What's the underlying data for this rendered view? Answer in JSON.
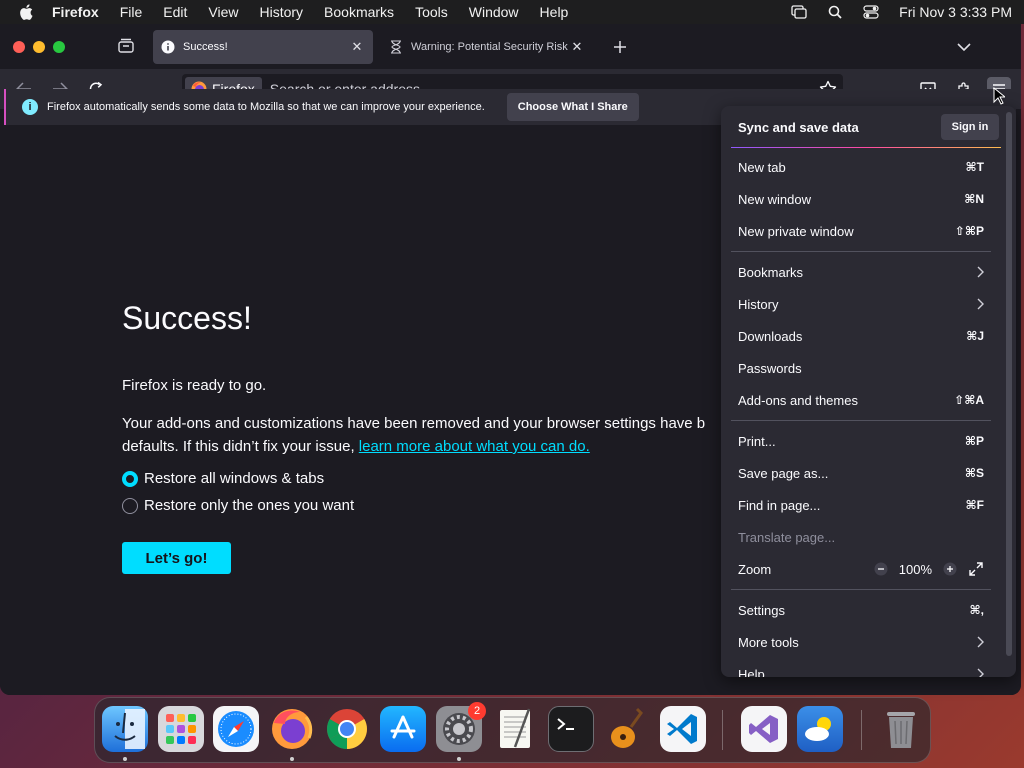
{
  "menubar": {
    "apple": "",
    "app_name": "Firefox",
    "items": [
      "File",
      "Edit",
      "View",
      "History",
      "Bookmarks",
      "Tools",
      "Window",
      "Help"
    ],
    "datetime": "Fri Nov 3  3:33 PM"
  },
  "tabs": [
    {
      "title": "Success!",
      "active": true
    },
    {
      "title": "Warning: Potential Security Risk",
      "active": false
    }
  ],
  "urlbar": {
    "identity_label": "Firefox",
    "placeholder": "Search or enter address"
  },
  "notification": {
    "message": "Firefox automatically sends some data to Mozilla so that we can improve your experience.",
    "button_label": "Choose What I Share"
  },
  "page": {
    "title": "Success!",
    "ready": "Firefox is ready to go.",
    "desc_line1": "Your add-ons and customizations have been removed and your browser settings have b",
    "desc_line2_prefix": "defaults. If this didn’t fix your issue, ",
    "desc_link": "learn more about what you can do.",
    "radio_restore_all": "Restore all windows & tabs",
    "radio_restore_some": "Restore only the ones you want",
    "go_button": "Let’s go!"
  },
  "appmenu": {
    "sync_label": "Sync and save data",
    "signin_label": "Sign in",
    "new_tab": {
      "label": "New tab",
      "shortcut": "⌘T"
    },
    "new_window": {
      "label": "New window",
      "shortcut": "⌘N"
    },
    "new_private_window": {
      "label": "New private window",
      "shortcut": "⇧⌘P"
    },
    "bookmarks": {
      "label": "Bookmarks"
    },
    "history": {
      "label": "History"
    },
    "downloads": {
      "label": "Downloads",
      "shortcut": "⌘J"
    },
    "passwords": {
      "label": "Passwords"
    },
    "addons": {
      "label": "Add-ons and themes",
      "shortcut": "⇧⌘A"
    },
    "print": {
      "label": "Print...",
      "shortcut": "⌘P"
    },
    "save_page": {
      "label": "Save page as...",
      "shortcut": "⌘S"
    },
    "find": {
      "label": "Find in page...",
      "shortcut": "⌘F"
    },
    "translate": {
      "label": "Translate page..."
    },
    "zoom": {
      "label": "Zoom",
      "value": "100%",
      "minus": "−",
      "plus": "+"
    },
    "settings": {
      "label": "Settings",
      "shortcut": "⌘,"
    },
    "more_tools": {
      "label": "More tools"
    },
    "help": {
      "label": "Help"
    }
  },
  "dock": {
    "apps": [
      "finder",
      "launchpad",
      "safari",
      "firefox",
      "chrome",
      "app-store",
      "system-settings",
      "textedit",
      "terminal",
      "garageband",
      "vscode",
      "visual-studio",
      "weather",
      "trash"
    ],
    "settings_badge": "2"
  },
  "colors": {
    "accent": "#00ddff",
    "page_bg": "#1c1b22",
    "panel_bg": "#2b2a33"
  }
}
